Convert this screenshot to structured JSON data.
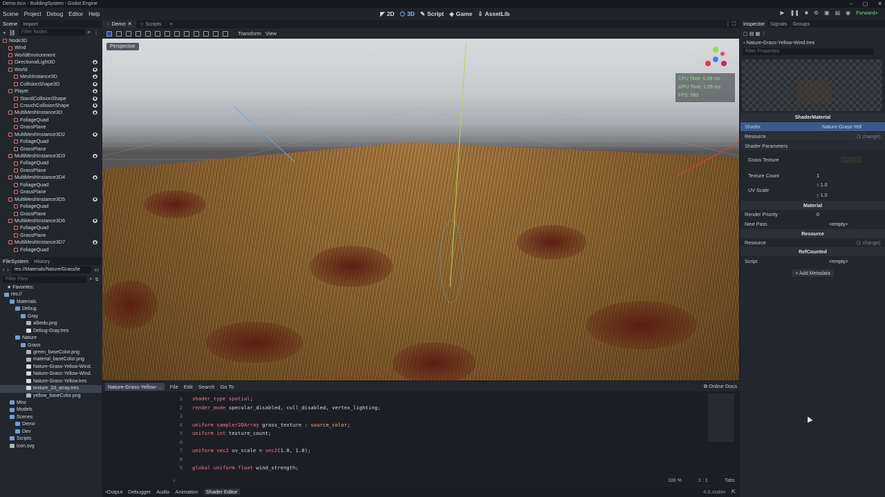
{
  "window": {
    "title": "Demo.tscn - BuildingSystem - Godot Engine"
  },
  "menu": [
    "Scene",
    "Project",
    "Debug",
    "Editor",
    "Help"
  ],
  "workspaces": [
    {
      "label": "2D",
      "active": false
    },
    {
      "label": "3D",
      "active": true
    },
    {
      "label": "Script",
      "active": false
    },
    {
      "label": "Game",
      "active": false
    },
    {
      "label": "AssetLib",
      "active": false
    }
  ],
  "renderer": "Forward+",
  "scene_dock": {
    "tabs": [
      "Scene",
      "Import"
    ],
    "filter_placeholder": "Filter Nodes",
    "nodes": [
      {
        "name": "Node3D",
        "depth": 0,
        "icon": "#e06c6c",
        "eye": false
      },
      {
        "name": "Wind",
        "depth": 1,
        "icon": "#e06c6c",
        "eye": false
      },
      {
        "name": "WorldEnvironment",
        "depth": 1,
        "icon": "#e06c6c",
        "eye": false
      },
      {
        "name": "DirectionalLight3D",
        "depth": 1,
        "icon": "#e06c6c",
        "eye": true
      },
      {
        "name": "World",
        "depth": 1,
        "icon": "#e06c6c",
        "eye": true
      },
      {
        "name": "MeshInstance3D",
        "depth": 2,
        "icon": "#e06c6c",
        "eye": true
      },
      {
        "name": "CollisionShape3D",
        "depth": 2,
        "icon": "#e06c6c",
        "eye": true
      },
      {
        "name": "Player",
        "depth": 1,
        "icon": "#e06c6c",
        "eye": true
      },
      {
        "name": "StandCollisionShape",
        "depth": 2,
        "icon": "#e06c6c",
        "eye": true
      },
      {
        "name": "CrouchCollisionShape",
        "depth": 2,
        "icon": "#e06c6c",
        "eye": true
      },
      {
        "name": "MultiMeshInstance3D",
        "depth": 1,
        "icon": "#e06c6c",
        "eye": true
      },
      {
        "name": "FoliageQuad",
        "depth": 2,
        "icon": "#e06c6c",
        "eye": false
      },
      {
        "name": "GrassPlane",
        "depth": 2,
        "icon": "#e06c6c",
        "eye": false
      },
      {
        "name": "MultiMeshInstance3D2",
        "depth": 1,
        "icon": "#e06c6c",
        "eye": true
      },
      {
        "name": "FoliageQuad",
        "depth": 2,
        "icon": "#e06c6c",
        "eye": false
      },
      {
        "name": "GrassPlane",
        "depth": 2,
        "icon": "#e06c6c",
        "eye": false
      },
      {
        "name": "MultiMeshInstance3D3",
        "depth": 1,
        "icon": "#e06c6c",
        "eye": true
      },
      {
        "name": "FoliageQuad",
        "depth": 2,
        "icon": "#e06c6c",
        "eye": false
      },
      {
        "name": "GrassPlane",
        "depth": 2,
        "icon": "#e06c6c",
        "eye": false
      },
      {
        "name": "MultiMeshInstance3D4",
        "depth": 1,
        "icon": "#e06c6c",
        "eye": true
      },
      {
        "name": "FoliageQuad",
        "depth": 2,
        "icon": "#e06c6c",
        "eye": false
      },
      {
        "name": "GrassPlane",
        "depth": 2,
        "icon": "#e06c6c",
        "eye": false
      },
      {
        "name": "MultiMeshInstance3D5",
        "depth": 1,
        "icon": "#e06c6c",
        "eye": true
      },
      {
        "name": "FoliageQuad",
        "depth": 2,
        "icon": "#e06c6c",
        "eye": false
      },
      {
        "name": "GrassPlane",
        "depth": 2,
        "icon": "#e06c6c",
        "eye": false
      },
      {
        "name": "MultiMeshInstance3D6",
        "depth": 1,
        "icon": "#e06c6c",
        "eye": true
      },
      {
        "name": "FoliageQuad",
        "depth": 2,
        "icon": "#e06c6c",
        "eye": false
      },
      {
        "name": "GrassPlane",
        "depth": 2,
        "icon": "#e06c6c",
        "eye": false
      },
      {
        "name": "MultiMeshInstance3D7",
        "depth": 1,
        "icon": "#e06c6c",
        "eye": true
      },
      {
        "name": "FoliageQuad",
        "depth": 2,
        "icon": "#e06c6c",
        "eye": false
      }
    ]
  },
  "fs_dock": {
    "tabs": [
      "FileSystem",
      "History"
    ],
    "path": "res://Materials/Nature/Grass/te",
    "filter_placeholder": "Filter Files",
    "favorites": "Favorites:",
    "items": [
      {
        "name": "res://",
        "depth": 0,
        "kind": "folder"
      },
      {
        "name": "Materials",
        "depth": 1,
        "kind": "folder"
      },
      {
        "name": "Debug",
        "depth": 2,
        "kind": "folder"
      },
      {
        "name": "Gray",
        "depth": 3,
        "kind": "folder"
      },
      {
        "name": "albedo.png",
        "depth": 4,
        "kind": "image"
      },
      {
        "name": "Debug-Gray.tres",
        "depth": 4,
        "kind": "res"
      },
      {
        "name": "Nature",
        "depth": 2,
        "kind": "folder"
      },
      {
        "name": "Grass",
        "depth": 3,
        "kind": "folder"
      },
      {
        "name": "green_baseColor.png",
        "depth": 4,
        "kind": "image"
      },
      {
        "name": "material_baseColor.png",
        "depth": 4,
        "kind": "image"
      },
      {
        "name": "Nature-Grass-Yellow-Wind.",
        "depth": 4,
        "kind": "res"
      },
      {
        "name": "Nature-Grass-Yellow-Wind.",
        "depth": 4,
        "kind": "res"
      },
      {
        "name": "Nature-Grass-Yellow.tres",
        "depth": 4,
        "kind": "res"
      },
      {
        "name": "texture_2d_array.tres",
        "depth": 4,
        "kind": "res",
        "selected": true
      },
      {
        "name": "yellow_baseColor.png",
        "depth": 4,
        "kind": "image"
      },
      {
        "name": "Misc",
        "depth": 1,
        "kind": "folder"
      },
      {
        "name": "Models",
        "depth": 1,
        "kind": "folder"
      },
      {
        "name": "Scenes",
        "depth": 1,
        "kind": "folder"
      },
      {
        "name": "Demo",
        "depth": 2,
        "kind": "folder"
      },
      {
        "name": "Dev",
        "depth": 2,
        "kind": "folder"
      },
      {
        "name": "Scripts",
        "depth": 1,
        "kind": "folder"
      },
      {
        "name": "icon.svg",
        "depth": 1,
        "kind": "image"
      }
    ]
  },
  "editor_tabs": [
    {
      "label": "Demo",
      "active": true
    },
    {
      "label": "Scripts",
      "active": false
    }
  ],
  "vp_toolbar": {
    "transform": "Transform",
    "view": "View"
  },
  "viewport": {
    "perspective": "Perspective",
    "cpu": "CPU Time: 0.09 ms",
    "gpu": "GPU Time: 1.09 ms",
    "fps": "FPS: 583"
  },
  "shader": {
    "file": "Nature-Grass-Yellow-...",
    "menu": [
      "File",
      "Edit",
      "Search",
      "Go To"
    ],
    "online_docs": "Online Docs",
    "lines": [
      {
        "n": "1",
        "code": "shader_type spatial;"
      },
      {
        "n": "2",
        "code": "render_mode specular_disabled, cull_disabled, vertex_lighting;"
      },
      {
        "n": "3",
        "code": ""
      },
      {
        "n": "4",
        "code": "uniform sampler2DArray grass_texture : source_color;"
      },
      {
        "n": "5",
        "code": "uniform int texture_count;"
      },
      {
        "n": "6",
        "code": ""
      },
      {
        "n": "7",
        "code": "uniform vec2 uv_scale = vec2(1.0, 1.0);"
      },
      {
        "n": "8",
        "code": ""
      },
      {
        "n": "9",
        "code": "global uniform float wind_strength;"
      }
    ],
    "zoom": "100 %",
    "cursor": "1 :    1",
    "indent": "Tabs"
  },
  "bottom_tabs": [
    "Output",
    "Debugger",
    "Audio",
    "Animation",
    "Shader Editor"
  ],
  "version": "4.6.stable",
  "inspector": {
    "tabs": [
      "Inspector",
      "Signals",
      "Groups"
    ],
    "resource_path": "Nature-Grass-Yellow-Wind.tres",
    "filter_placeholder": "Filter Properties",
    "class": "ShaderMaterial",
    "shader_label": "Shader",
    "shader_value": "Nature-Grass-Yell",
    "resource": "Resource",
    "resource_change": "(1 change)",
    "shader_params": "Shader Parameters",
    "grass_texture": "Grass Texture",
    "texture_count": "Texture Count",
    "texture_count_value": "1",
    "uv_scale": "UV Scale",
    "uv_x": "1.0",
    "uv_y": "1.0",
    "material": "Material",
    "render_priority": "Render Priority",
    "render_priority_value": "0",
    "next_pass": "Next Pass",
    "empty": "<empty>",
    "resource2": "Resource",
    "resource2_change": "(1 change)",
    "refcounted": "RefCounted",
    "script": "Script",
    "add_metadata": "Add Metadata"
  }
}
